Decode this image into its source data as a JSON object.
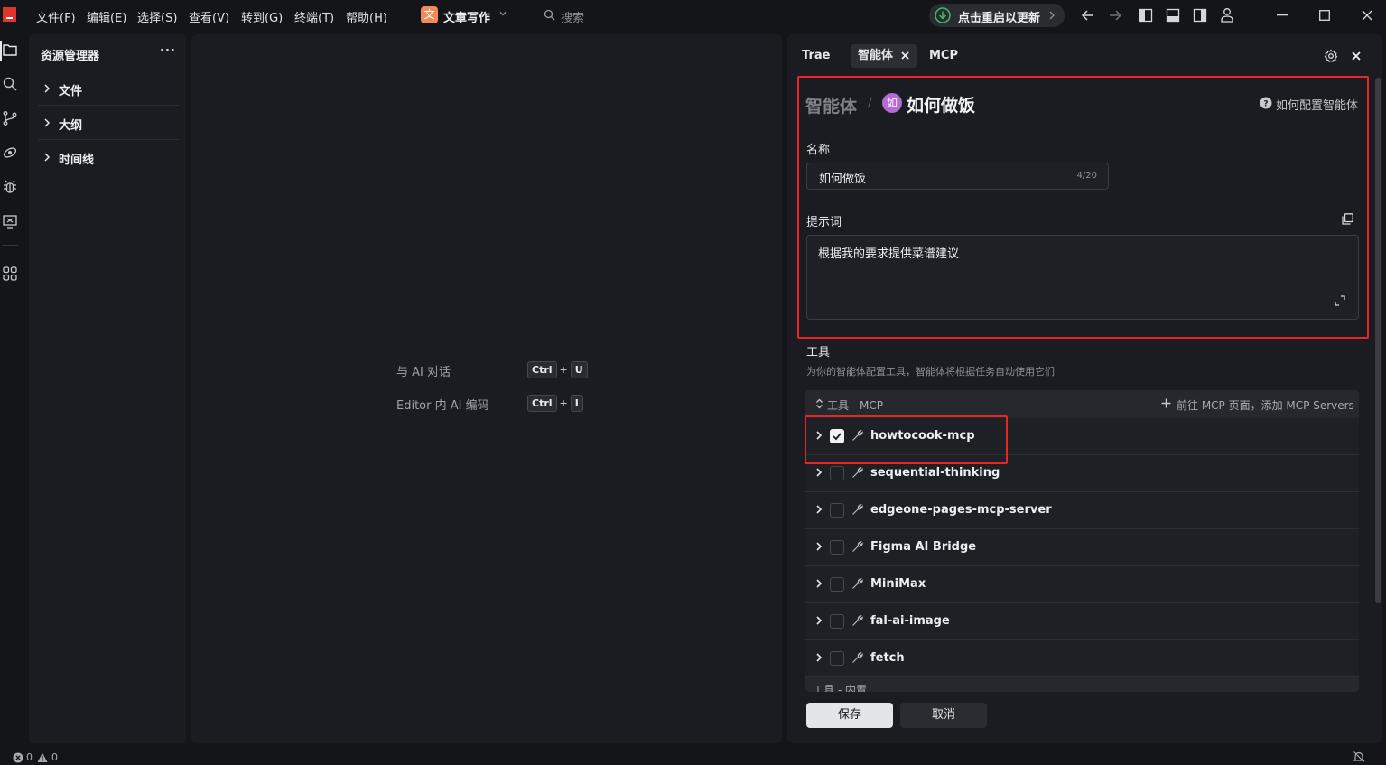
{
  "titlebar": {
    "menus": [
      "文件(F)",
      "编辑(E)",
      "选择(S)",
      "查看(V)",
      "转到(G)",
      "终端(T)",
      "帮助(H)"
    ],
    "project_badge": "文",
    "project_name": "文章写作",
    "search_placeholder": "搜索",
    "update_label": "点击重启以更新"
  },
  "explorer": {
    "title": "资源管理器",
    "more": "···",
    "items": [
      "文件",
      "大纲",
      "时间线"
    ]
  },
  "editor": {
    "hints": [
      {
        "label": "与 AI 对话",
        "keys": [
          "Ctrl",
          "+",
          "U"
        ]
      },
      {
        "label": "Editor 内 AI 编码",
        "keys": [
          "Ctrl",
          "+",
          "I"
        ]
      }
    ]
  },
  "panel": {
    "tabs": [
      "Trae",
      "智能体",
      "MCP"
    ],
    "breadcrumb_root": "智能体",
    "breadcrumb_sep": "/",
    "agent_avatar": "如",
    "agent_title": "如何做饭",
    "help_link": "如何配置智能体",
    "name_label": "名称",
    "name_value": "如何做饭",
    "name_counter": "4/20",
    "prompt_label": "提示词",
    "prompt_value": "根据我的要求提供菜谱建议",
    "tools_label": "工具",
    "tools_desc": "为你的智能体配置工具，智能体将根据任务自动使用它们",
    "tools_group": "工具 - MCP",
    "tools_add": "前往 MCP 页面，添加 MCP Servers",
    "mcp_items": [
      {
        "name": "howtocook-mcp",
        "checked": true
      },
      {
        "name": "sequential-thinking",
        "checked": false
      },
      {
        "name": "edgeone-pages-mcp-server",
        "checked": false
      },
      {
        "name": "Figma AI Bridge",
        "checked": false
      },
      {
        "name": "MiniMax",
        "checked": false
      },
      {
        "name": "fal-ai-image",
        "checked": false
      },
      {
        "name": "fetch",
        "checked": false
      }
    ],
    "tools_builtin_partial": "工具 - 内置",
    "save_label": "保存",
    "cancel_label": "取消"
  },
  "statusbar": {
    "errors": "0",
    "warnings": "0"
  },
  "colors": {
    "background": "#141519",
    "panel": "#1b1c21",
    "highlight": "#e5262b",
    "accent_avatar": "#b46bd8",
    "update_green": "#3fbf5f"
  }
}
